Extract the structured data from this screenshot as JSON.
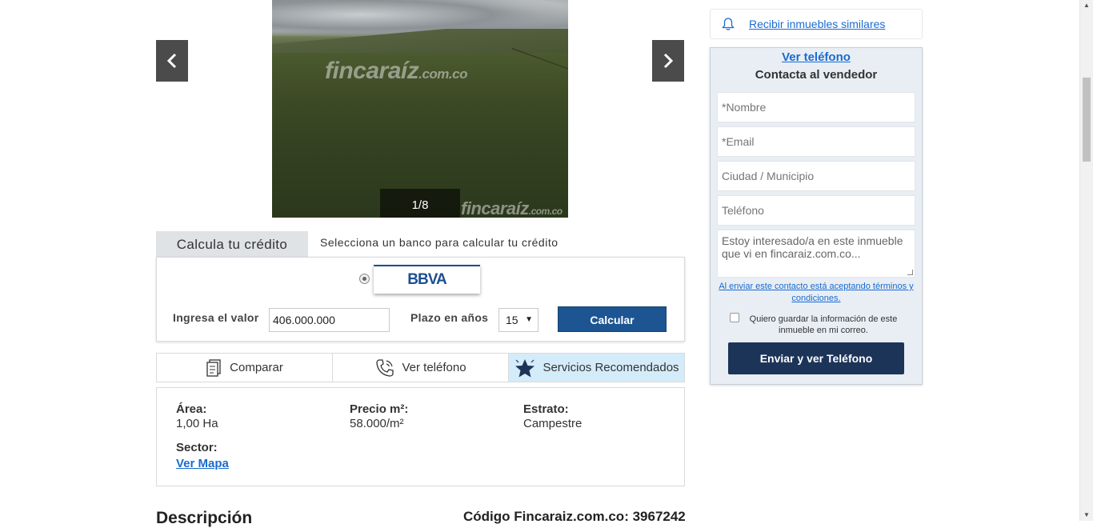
{
  "gallery": {
    "watermark": "fincaraíz",
    "watermark_suffix": ".com.co",
    "counter": "1/8"
  },
  "credit": {
    "tab_label": "Calcula tu crédito",
    "hint": "Selecciona un banco para calcular tu crédito",
    "bank_name": "BBVA",
    "value_label": "Ingresa el valor",
    "value": "406.000.000",
    "years_label": "Plazo en años",
    "years": "15",
    "calc_button": "Calcular"
  },
  "actions": {
    "compare": "Comparar",
    "phone": "Ver teléfono",
    "services": "Servicios Recomendados"
  },
  "details": {
    "area_label": "Área:",
    "area_value": "1,00 Ha",
    "price_label": "Precio m²:",
    "price_value": "58.000/m²",
    "stratum_label": "Estrato:",
    "stratum_value": "Campestre",
    "sector_label": "Sector:",
    "map_link": "Ver Mapa"
  },
  "description": {
    "title": "Descripción",
    "code": "Código Fincaraiz.com.co: 3967242"
  },
  "sidebar": {
    "alert_link": "Recibir inmuebles similares",
    "ver_telefono": "Ver teléfono",
    "contact_title": "Contacta al vendedor",
    "name_placeholder": "*Nombre",
    "email_placeholder": "*Email",
    "city_placeholder": "Ciudad / Municipio",
    "phone_placeholder": "Teléfono",
    "message": "Estoy interesado/a en este inmueble que vi en fincaraiz.com.co...",
    "terms": "Al enviar este contacto está aceptando términos y condiciones.",
    "save_info": "Quiero guardar la información de este inmueble en mi correo.",
    "send_button": "Enviar y ver Teléfono"
  },
  "colors": {
    "accent_blue": "#1d5592",
    "link_blue": "#1a6bd0",
    "send_button": "#1c3458",
    "services_bg": "#d4ecf9"
  }
}
